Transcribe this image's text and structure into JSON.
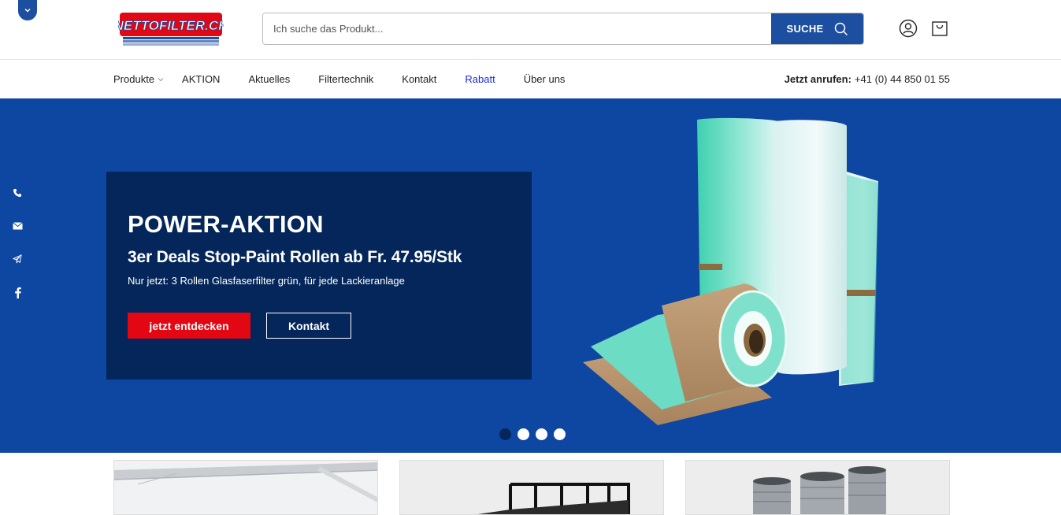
{
  "header": {
    "logo_text": "NETTOFILTER.CH",
    "search": {
      "placeholder": "Ich suche das Produkt...",
      "value": "",
      "button_label": "SUCHE"
    }
  },
  "nav": {
    "items": [
      {
        "label": "Produkte"
      },
      {
        "label": "AKTION"
      },
      {
        "label": "Aktuelles"
      },
      {
        "label": "Filtertechnik"
      },
      {
        "label": "Kontakt"
      },
      {
        "label": "Rabatt"
      },
      {
        "label": "Über uns"
      }
    ],
    "phone_prefix": "Jetzt anrufen:",
    "phone_number": "+41 (0) 44 850 01 55"
  },
  "hero": {
    "title": "POWER-AKTION",
    "subtitle": "3er Deals Stop-Paint Rollen ab Fr. 47.95/Stk",
    "description": "Nur jetzt: 3 Rollen Glasfaserfilter grün, für jede Lackieranlage",
    "primary_cta": "jetzt entdecken",
    "secondary_cta": "Kontakt",
    "slides_total": 4,
    "active_slide": 1
  },
  "social_icons": [
    "phone-icon",
    "mail-icon",
    "telegram-icon",
    "facebook-icon"
  ],
  "colors": {
    "brand_blue": "#1d4fa0",
    "hero_bg": "#0d47a1",
    "promo_bg": "#04265a",
    "cta_red": "#e30613",
    "nav_highlight": "#1d2bd6"
  }
}
